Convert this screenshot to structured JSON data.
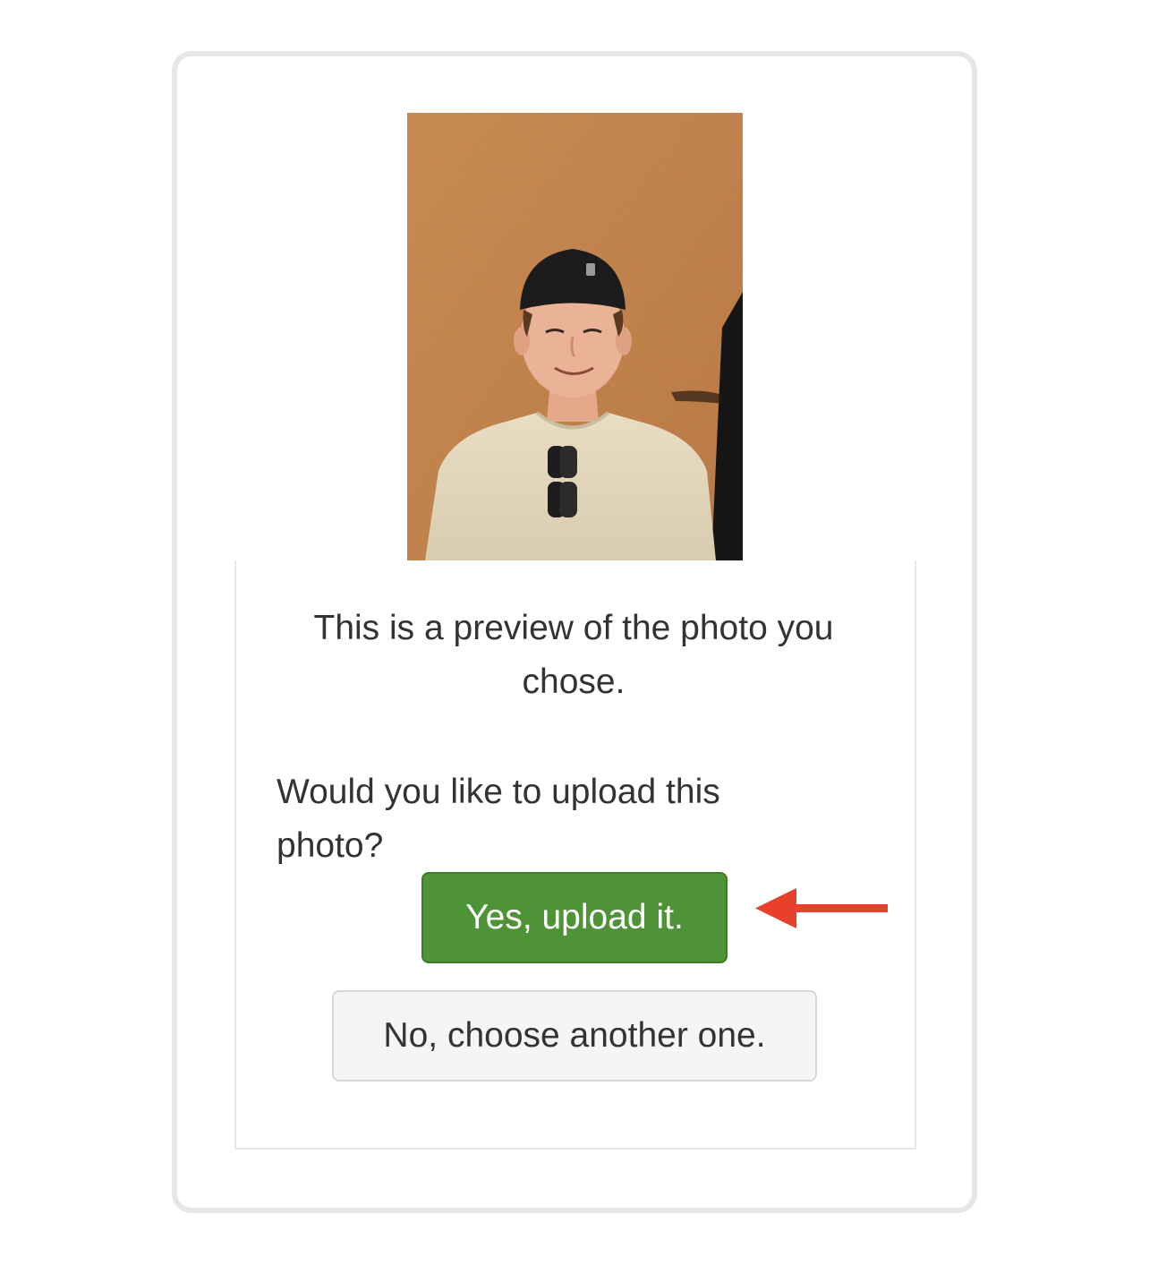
{
  "preview": {
    "photo_description_icon": "person-photo",
    "caption": "This is a preview of the photo you chose.",
    "question": "Would you like to upload this photo?"
  },
  "actions": {
    "yes_label": "Yes, upload it.",
    "no_label": "No, choose another one."
  },
  "annotation": {
    "arrow_icon": "arrow-left-icon",
    "arrow_color": "#e8402a"
  },
  "colors": {
    "primary_button": "#4f9337",
    "secondary_button": "#f5f5f5",
    "frame_border": "#e6e6e6"
  }
}
